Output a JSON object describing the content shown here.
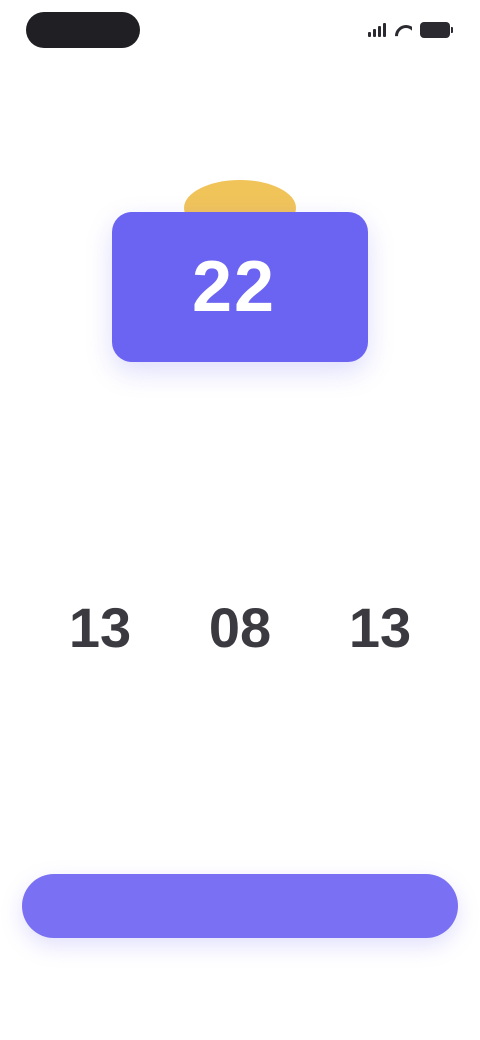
{
  "status_bar": {
    "time": "",
    "icons": [
      "signal-icon",
      "wifi-icon",
      "battery-icon"
    ]
  },
  "calendar": {
    "day": "22",
    "month": "",
    "weekday": "",
    "card_color": "#6b63f2",
    "tab_color": "#f1c45a"
  },
  "title": "",
  "subtitle": "",
  "countdown": [
    {
      "value": "13",
      "label": ""
    },
    {
      "value": "08",
      "label": ""
    },
    {
      "value": "13",
      "label": ""
    }
  ],
  "note": "",
  "primary_button": {
    "label": "",
    "color": "#7a70f3"
  },
  "secondary_link": {
    "label": ""
  }
}
